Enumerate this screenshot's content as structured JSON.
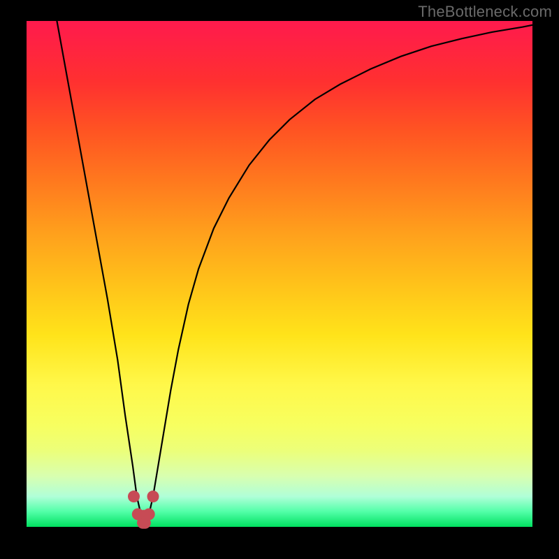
{
  "watermark": "TheBottleneck.com",
  "chart_data": {
    "type": "line",
    "title": "",
    "xlabel": "",
    "ylabel": "",
    "xlim": [
      0,
      100
    ],
    "ylim": [
      0,
      100
    ],
    "grid": false,
    "series": [
      {
        "name": "bottleneck-curve",
        "color": "#000000",
        "x": [
          6,
          8,
          10,
          12,
          14,
          16,
          18,
          19.5,
          21,
          21.8,
          22.6,
          23.4,
          24.2,
          25,
          26,
          27,
          28.5,
          30,
          32,
          34,
          37,
          40,
          44,
          48,
          52,
          57,
          62,
          68,
          74,
          80,
          86,
          92,
          98,
          100
        ],
        "y": [
          100,
          89,
          78,
          67,
          56,
          45,
          33,
          22,
          12,
          6,
          2.5,
          1.2,
          2.5,
          6,
          12,
          18,
          27,
          35,
          44,
          51,
          59,
          65,
          71.5,
          76.5,
          80.5,
          84.5,
          87.5,
          90.5,
          93,
          95,
          96.5,
          97.8,
          98.8,
          99.2
        ]
      },
      {
        "name": "valley-marker",
        "color": "#c74b55",
        "type": "scatter",
        "x": [
          21.2,
          22.0,
          23.0,
          23.2,
          23.4,
          24.2,
          25.0
        ],
        "y": [
          6.0,
          2.5,
          0.8,
          2.2,
          0.8,
          2.5,
          6.0
        ]
      }
    ]
  },
  "icons": {
    "curve": "bottleneck-curve",
    "marker": "valley-marker"
  }
}
